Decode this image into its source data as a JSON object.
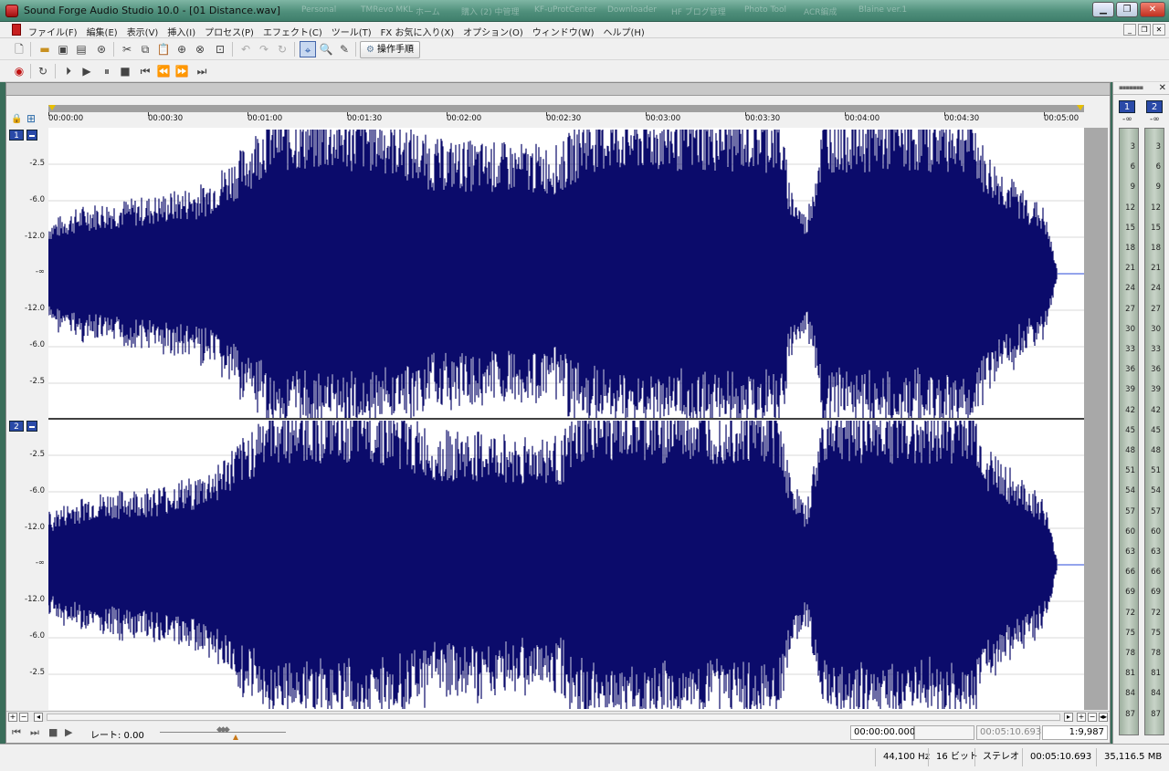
{
  "window": {
    "title": "Sound Forge Audio Studio 10.0 - [01 Distance.wav]",
    "background_tabs": [
      "Personal",
      "TMRevo MKL",
      "ホーム",
      "購入 (2) 中管理",
      "KF-uProtCenter",
      "Downloader",
      "HF ブログ管理",
      "Photo Tool",
      "ACR編成",
      "Blaine ver.1"
    ]
  },
  "menu": {
    "items": [
      "ファイル(F)",
      "編集(E)",
      "表示(V)",
      "挿入(I)",
      "プロセス(P)",
      "エフェクト(C)",
      "ツール(T)",
      "FX お気に入り(X)",
      "オプション(O)",
      "ウィンドウ(W)",
      "ヘルプ(H)"
    ]
  },
  "toolbar": {
    "steps_label": "操作手順"
  },
  "timeline": {
    "ticks": [
      "00:00:00",
      "00:00:30",
      "00:01:00",
      "00:01:30",
      "00:02:00",
      "00:02:30",
      "00:03:00",
      "00:03:30",
      "00:04:00",
      "00:04:30",
      "00:05:00"
    ]
  },
  "channels": [
    {
      "number": "1",
      "db_labels": [
        "-2.5",
        "-6.0",
        "-12.0",
        "-∞",
        "-12.0",
        "-6.0",
        "-2.5"
      ]
    },
    {
      "number": "2",
      "db_labels": [
        "-2.5",
        "-6.0",
        "-12.0",
        "-∞",
        "-12.0",
        "-6.0",
        "-2.5"
      ]
    }
  ],
  "transport": {
    "rate_label": "レート: 0.00",
    "selection_start": "00:00:00.000",
    "selection_length": "",
    "selection_end": "00:05:10.693",
    "zoom_ratio": "1:9,987"
  },
  "meter": {
    "channels": [
      "1",
      "2"
    ],
    "peak": [
      "-∞",
      "-∞"
    ],
    "scale": [
      "3",
      "6",
      "9",
      "12",
      "15",
      "18",
      "21",
      "24",
      "27",
      "30",
      "33",
      "36",
      "39",
      "42",
      "45",
      "48",
      "51",
      "54",
      "57",
      "60",
      "63",
      "66",
      "69",
      "72",
      "75",
      "78",
      "81",
      "84",
      "87"
    ]
  },
  "status": {
    "sample_rate": "44,100 Hz",
    "bit_depth": "16 ビット",
    "channels": "ステレオ",
    "length": "00:05:10.693",
    "free_space": "35,116.5 MB"
  },
  "colors": {
    "waveform": "#0b0b6b",
    "selection_blue": "#2a4aa8"
  }
}
